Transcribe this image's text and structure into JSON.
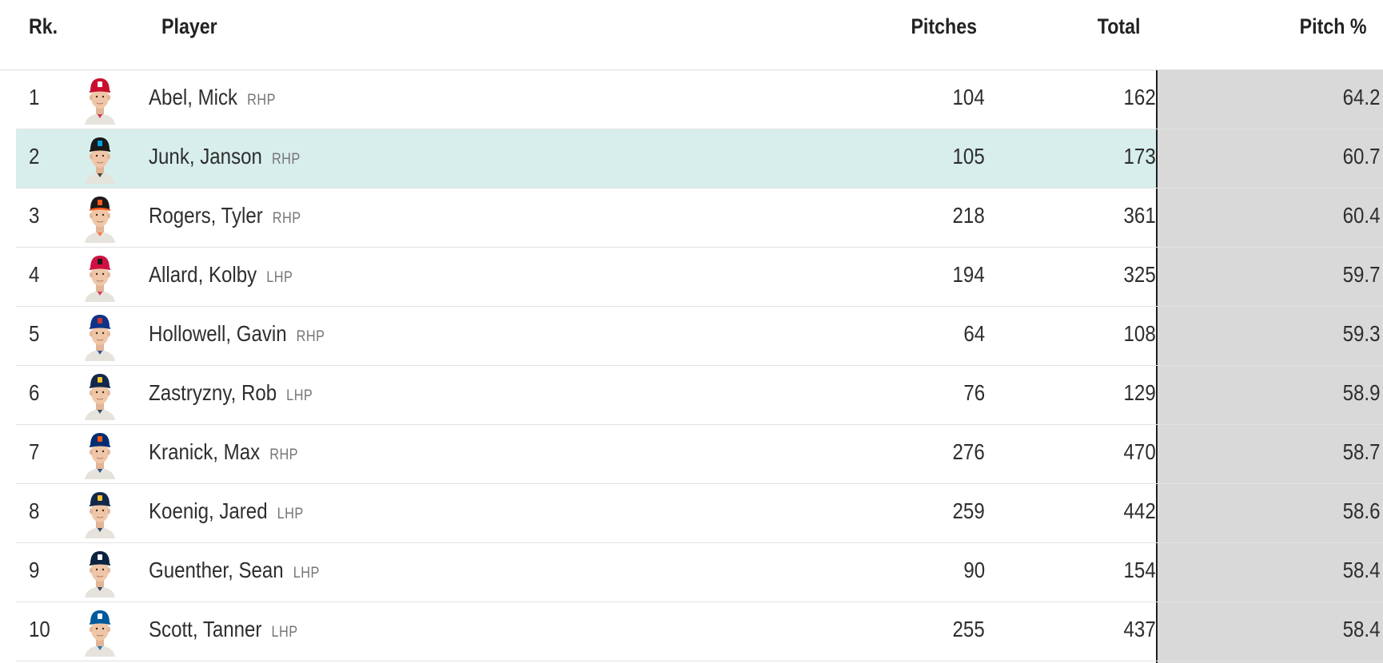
{
  "table": {
    "headers": {
      "rank": "Rk.",
      "player": "Player",
      "pitches": "Pitches",
      "total": "Total",
      "pct": "Pitch %"
    },
    "highlighted_rank": "2",
    "rows": [
      {
        "rank": "1",
        "name": "Abel, Mick",
        "hand": "RHP",
        "pitches": "104",
        "total": "162",
        "pct": "64.2",
        "cap_color": "#c8102e",
        "brim_color": "#c8102e",
        "logo_color": "#ffffff"
      },
      {
        "rank": "2",
        "name": "Junk, Janson",
        "hand": "RHP",
        "pitches": "105",
        "total": "173",
        "pct": "60.7",
        "cap_color": "#1a1a1a",
        "brim_color": "#1a1a1a",
        "logo_color": "#00a3e0"
      },
      {
        "rank": "3",
        "name": "Rogers, Tyler",
        "hand": "RHP",
        "pitches": "218",
        "total": "361",
        "pct": "60.4",
        "cap_color": "#1a1a1a",
        "brim_color": "#fd5a1e",
        "logo_color": "#fd5a1e"
      },
      {
        "rank": "4",
        "name": "Allard, Kolby",
        "hand": "LHP",
        "pitches": "194",
        "total": "325",
        "pct": "59.7",
        "cap_color": "#ce1141",
        "brim_color": "#ce1141",
        "logo_color": "#1a1a1a"
      },
      {
        "rank": "5",
        "name": "Hollowell, Gavin",
        "hand": "RHP",
        "pitches": "64",
        "total": "108",
        "pct": "59.3",
        "cap_color": "#0e3386",
        "brim_color": "#0e3386",
        "logo_color": "#cc3433"
      },
      {
        "rank": "6",
        "name": "Zastryzny, Rob",
        "hand": "LHP",
        "pitches": "76",
        "total": "129",
        "pct": "58.9",
        "cap_color": "#12284b",
        "brim_color": "#12284b",
        "logo_color": "#ffc52f"
      },
      {
        "rank": "7",
        "name": "Kranick, Max",
        "hand": "RHP",
        "pitches": "276",
        "total": "470",
        "pct": "58.7",
        "cap_color": "#002d72",
        "brim_color": "#002d72",
        "logo_color": "#ff5910"
      },
      {
        "rank": "8",
        "name": "Koenig, Jared",
        "hand": "LHP",
        "pitches": "259",
        "total": "442",
        "pct": "58.6",
        "cap_color": "#12284b",
        "brim_color": "#12284b",
        "logo_color": "#ffc52f"
      },
      {
        "rank": "9",
        "name": "Guenther, Sean",
        "hand": "LHP",
        "pitches": "90",
        "total": "154",
        "pct": "58.4",
        "cap_color": "#0c2340",
        "brim_color": "#0c2340",
        "logo_color": "#ffffff"
      },
      {
        "rank": "10",
        "name": "Scott, Tanner",
        "hand": "LHP",
        "pitches": "255",
        "total": "437",
        "pct": "58.4",
        "cap_color": "#005a9c",
        "brim_color": "#005a9c",
        "logo_color": "#ffffff"
      }
    ]
  }
}
